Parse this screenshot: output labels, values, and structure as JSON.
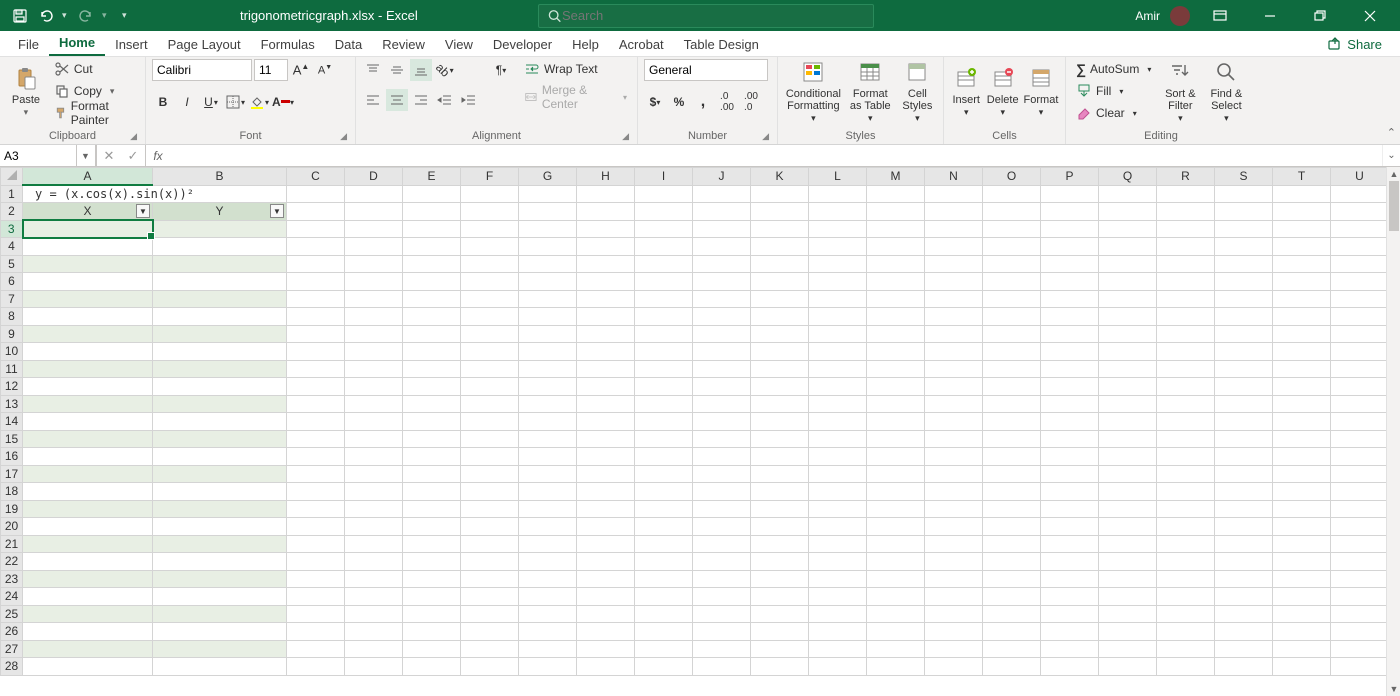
{
  "title": {
    "filename": "trigonometricgraph.xlsx",
    "sep": " - ",
    "app": "Excel"
  },
  "search": {
    "placeholder": "Search"
  },
  "user": {
    "name": "Amir"
  },
  "tabs": [
    "File",
    "Home",
    "Insert",
    "Page Layout",
    "Formulas",
    "Data",
    "Review",
    "View",
    "Developer",
    "Help",
    "Acrobat",
    "Table Design"
  ],
  "active_tab": "Home",
  "share": "Share",
  "ribbon": {
    "clipboard": {
      "label": "Clipboard",
      "paste": "Paste",
      "cut": "Cut",
      "copy": "Copy",
      "format_painter": "Format Painter"
    },
    "font": {
      "label": "Font",
      "name": "Calibri",
      "size": "11"
    },
    "alignment": {
      "label": "Alignment",
      "wrap": "Wrap Text",
      "merge": "Merge & Center"
    },
    "number": {
      "label": "Number",
      "format": "General"
    },
    "styles": {
      "label": "Styles",
      "conditional": "Conditional Formatting",
      "table": "Format as Table",
      "cell": "Cell Styles"
    },
    "cells": {
      "label": "Cells",
      "insert": "Insert",
      "delete": "Delete",
      "format": "Format"
    },
    "editing": {
      "label": "Editing",
      "autosum": "AutoSum",
      "fill": "Fill",
      "clear": "Clear",
      "sort": "Sort & Filter",
      "find": "Find & Select"
    }
  },
  "namebox": "A3",
  "formula": "",
  "columns": [
    "A",
    "B",
    "C",
    "D",
    "E",
    "F",
    "G",
    "H",
    "I",
    "J",
    "K",
    "L",
    "M",
    "N",
    "O",
    "P",
    "Q",
    "R",
    "S",
    "T",
    "U"
  ],
  "table": {
    "formula_display": "y = (x.cos(x).sin(x))²",
    "headers": [
      "X",
      "Y"
    ]
  },
  "row_count": 28,
  "active_cell": {
    "col": "A",
    "row": 3
  }
}
